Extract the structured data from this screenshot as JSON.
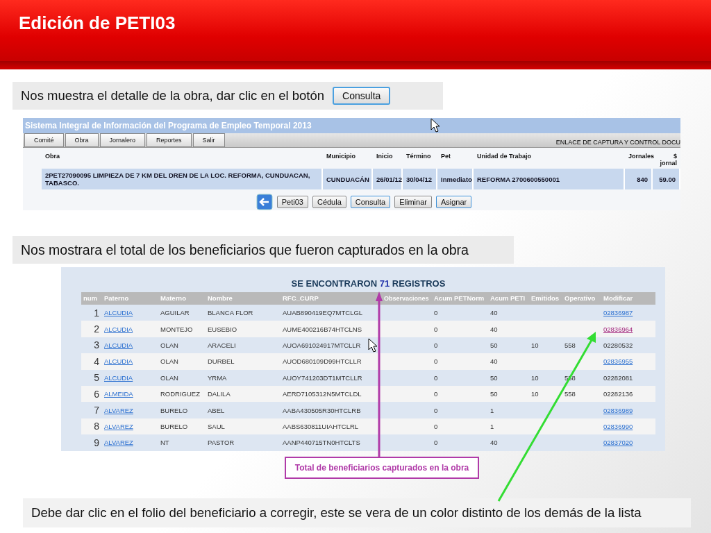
{
  "slide": {
    "title": "Edición de PETI03"
  },
  "caption_1": {
    "text": "Nos muestra el detalle de la obra, dar clic en el botón",
    "button": "Consulta"
  },
  "app_window": {
    "title": "Sistema Integral de Información del Programa de Empleo Temporal 2013",
    "menu": [
      "Comité",
      "Obra",
      "Jornalero",
      "Reportes",
      "Salir"
    ],
    "toolbar_text": "ENLACE DE CAPTURA Y CONTROL DOCU",
    "columns": [
      "Obra",
      "Municipio",
      "Inicio",
      "Término",
      "Pet",
      "Unidad de Trabajo",
      "Jornales",
      "$ jornal"
    ],
    "row": [
      "2PET27090095   LIMPIEZA DE 7 KM DEL DREN DE LA LOC. REFORMA, CUNDUACAN, TABASCO.",
      "CUNDUACÁN",
      "26/01/12",
      "30/04/12",
      "Inmediato",
      "REFORMA 2700600550001",
      "840",
      "59.00"
    ],
    "actions": [
      {
        "label": "Peti03",
        "highlighted": false
      },
      {
        "label": "Cédula",
        "highlighted": false
      },
      {
        "label": "Consulta",
        "highlighted": true
      },
      {
        "label": "Eliminar",
        "highlighted": false
      },
      {
        "label": "Asignar",
        "highlighted": true
      }
    ]
  },
  "caption_2": {
    "text": "Nos mostrara el total de los beneficiarios que fueron capturados en la obra"
  },
  "results": {
    "heading_before": "SE ENCONTRARON",
    "count": "71",
    "heading_after": "REGISTROS",
    "columns": [
      "num",
      "Paterno",
      "Materno",
      "Nombre",
      "RFC_CURP",
      "Observaciones",
      "Acum PETNorm",
      "Acum PETI",
      "Emitidos",
      "Operativo",
      "Modificar"
    ],
    "rows": [
      {
        "num": "1",
        "paterno": "ALCUDIA",
        "materno": "AGUILAR",
        "nombre": "BLANCA FLOR",
        "rfc": "AUAB890419EQ7MTCLGL",
        "petnorm": "0",
        "peti": "40",
        "folio": "02836987",
        "folio_linked": true,
        "selected": false
      },
      {
        "num": "2",
        "paterno": "ALCUDIA",
        "materno": "MONTEJO",
        "nombre": "EUSEBIO",
        "rfc": "AUME400216B74HTCLNS",
        "petnorm": "0",
        "peti": "40",
        "folio": "02836964",
        "folio_linked": true,
        "selected": true
      },
      {
        "num": "3",
        "paterno": "ALCUDIA",
        "materno": "OLAN",
        "nombre": "ARACELI",
        "rfc": "AUOA691024917MTCLLR",
        "petnorm": "0",
        "peti": "50",
        "emitidos": "10",
        "operativo": "558",
        "folio": "02280532",
        "folio_linked": false,
        "selected": false
      },
      {
        "num": "4",
        "paterno": "ALCUDIA",
        "materno": "OLAN",
        "nombre": "DURBEL",
        "rfc": "AUOD680109D99HTCLLR",
        "petnorm": "0",
        "peti": "40",
        "folio": "02836955",
        "folio_linked": true,
        "selected": false
      },
      {
        "num": "5",
        "paterno": "ALCUDIA",
        "materno": "OLAN",
        "nombre": "YRMA",
        "rfc": "AUOY741203DT1MTCLLR",
        "petnorm": "0",
        "peti": "50",
        "emitidos": "10",
        "operativo": "558",
        "folio": "02282081",
        "folio_linked": false,
        "selected": false
      },
      {
        "num": "6",
        "paterno": "ALMEIDA",
        "materno": "RODRIGUEZ",
        "nombre": "DALILA",
        "rfc": "AERD7105312N5MTCLDL",
        "petnorm": "0",
        "peti": "50",
        "emitidos": "10",
        "operativo": "558",
        "folio": "02282136",
        "folio_linked": false,
        "selected": false
      },
      {
        "num": "7",
        "paterno": "ALVAREZ",
        "materno": "BURELO",
        "nombre": "ABEL",
        "rfc": "AABA430505R30HTCLRB",
        "petnorm": "0",
        "peti": "1",
        "folio": "02836989",
        "folio_linked": true,
        "selected": false
      },
      {
        "num": "8",
        "paterno": "ALVAREZ",
        "materno": "BURELO",
        "nombre": "SAUL",
        "rfc": "AABS630811UIAHTCLRL",
        "petnorm": "0",
        "peti": "1",
        "folio": "02836990",
        "folio_linked": true,
        "selected": false
      },
      {
        "num": "9",
        "paterno": "ALVAREZ",
        "materno": "NT",
        "nombre": "PASTOR",
        "rfc": "AANP440715TN0HTCLTS",
        "petnorm": "0",
        "peti": "40",
        "folio": "02837020",
        "folio_linked": true,
        "selected": false
      }
    ]
  },
  "callout": {
    "text": "Total de beneficiarios capturados en la obra"
  },
  "caption_3": {
    "text": "Debe dar clic en el folio del beneficiario a corregir, este se vera de un color distinto de los demás de la lista"
  }
}
